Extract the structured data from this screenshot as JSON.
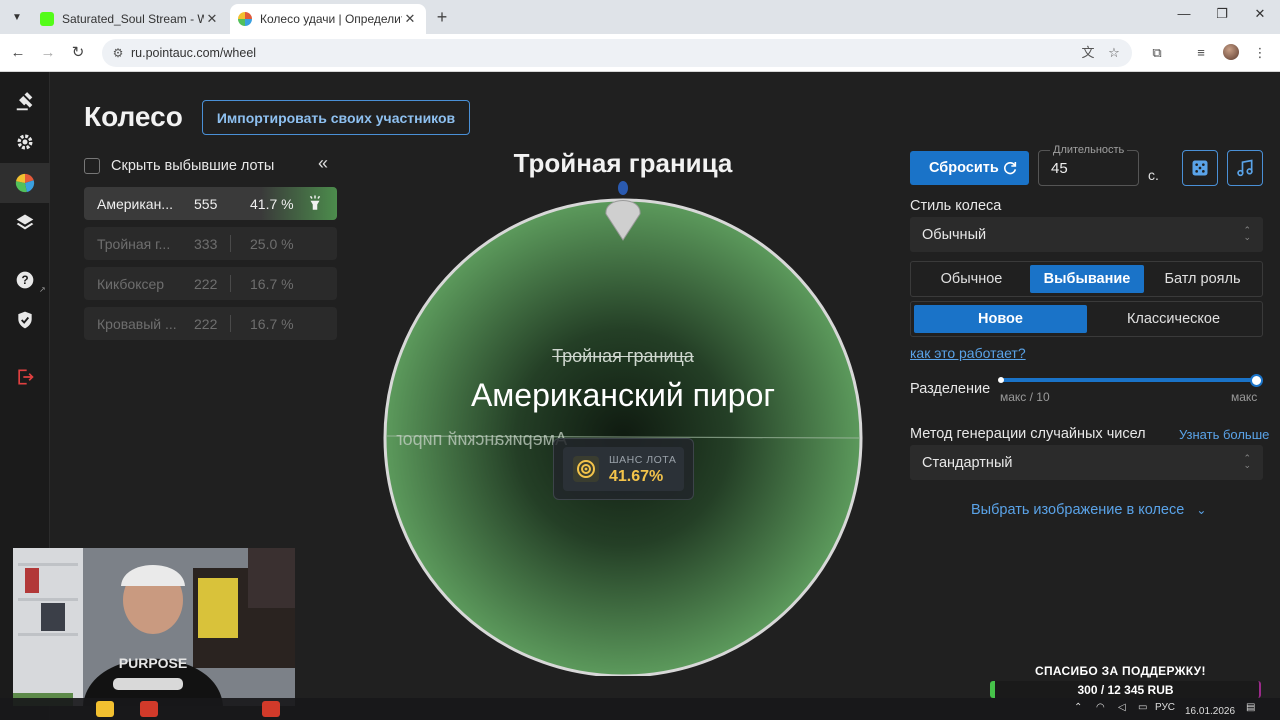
{
  "browser": {
    "tabs": [
      {
        "label": "Saturated_Soul Stream - Watch",
        "favicon_color": "#53fc18",
        "active": false
      },
      {
        "label": "Колесо удачи | Определите п",
        "favicon_color": "#e05a3a",
        "active": true
      }
    ],
    "url": "ru.pointauc.com/wheel"
  },
  "sidebar": {
    "icons": [
      "gavel-icon",
      "gear-icon",
      "pie-chart-icon",
      "layers-icon",
      "help-icon",
      "shield-check-icon",
      "logout-icon"
    ]
  },
  "header": {
    "title": "Колесо",
    "import_button": "Импортировать своих участников"
  },
  "lots_panel": {
    "hide_eliminated_label": "Скрыть выбывшие лоты",
    "lots": [
      {
        "name": "Американ...",
        "amount": "555",
        "percent": "41.7 %",
        "state": "active"
      },
      {
        "name": "Тройная г...",
        "amount": "333",
        "percent": "25.0 %",
        "state": "eliminated"
      },
      {
        "name": "Кикбоксер",
        "amount": "222",
        "percent": "16.7 %",
        "state": "eliminated"
      },
      {
        "name": "Кровавый ...",
        "amount": "222",
        "percent": "16.7 %",
        "state": "eliminated"
      }
    ]
  },
  "wheel": {
    "top_title": "Тройная граница",
    "crossed_out": "Тройная граница",
    "winner": "Американский пирог",
    "mirrored_text": "Американский пирог",
    "chance_label": "ШАНС ЛОТА",
    "chance_value": "41.67%",
    "accent": "#f3c34a"
  },
  "controls": {
    "reset_label": "Сбросить",
    "duration_legend": "Длительность",
    "duration_value": "45",
    "duration_unit": "с.",
    "wheel_style_label": "Стиль колеса",
    "wheel_style_value": "Обычный",
    "modes": [
      {
        "label": "Обычное",
        "selected": false
      },
      {
        "label": "Выбывание",
        "selected": true
      },
      {
        "label": "Батл рояль",
        "selected": false
      }
    ],
    "variants": [
      {
        "label": "Новое",
        "selected": true
      },
      {
        "label": "Классическое",
        "selected": false
      }
    ],
    "how_it_works": "как это работает?",
    "split_label": "Разделение",
    "split_min_caption": "макс / 10",
    "split_max_caption": "макс",
    "split_fraction": 1.0,
    "rng_label": "Метод генерации случайных чисел",
    "rng_learn_more": "Узнать больше",
    "rng_value": "Стандартный",
    "choose_image": "Выбрать изображение в колесе",
    "primary_color": "#1a73c8"
  },
  "donation": {
    "title": "СПАСИБО ЗА ПОДДЕРЖКУ!",
    "progress": "300 / 12 345 RUB"
  },
  "taskbar": {
    "lang": "РУС",
    "date": "16.01.2026"
  }
}
